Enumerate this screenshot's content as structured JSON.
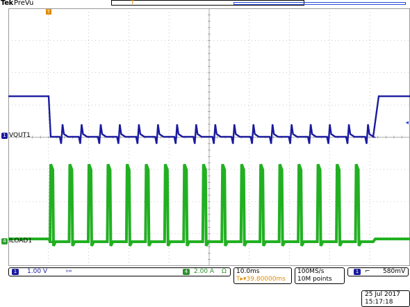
{
  "header": {
    "brand": "Tek",
    "mode": "PreVu",
    "record_trigger_glyph": "T"
  },
  "markers": {
    "ch1_number": "1",
    "ch1_label": "VOUT1",
    "ch4_number": "4",
    "ch4_label": "ILOAD1",
    "trigger_glyph": "T",
    "trigger_level_glyph": "◂"
  },
  "channel_settings": {
    "ch1_number": "1",
    "ch1_scale": "1.00 V",
    "ch1_bw_symbol": "ᵇᵂ",
    "ch4_number": "4",
    "ch4_scale": "2.00 A",
    "ch4_unit_symbol": "Ω"
  },
  "timebase": {
    "scale": "10.0ms",
    "position": "T▸▾39.80000ms"
  },
  "acquisition": {
    "sample_rate": "100MS/s",
    "record_length": "10M points"
  },
  "trigger": {
    "source": "1",
    "slope": "⌐",
    "level": "580mV"
  },
  "datetime": {
    "date": "25 Jul  2017",
    "time": "15:17:18"
  },
  "colors": {
    "ch1": "#1a1a9e",
    "ch4": "#22b022",
    "trigger": "#e08a00",
    "graticule": "#999999"
  },
  "waveform": {
    "ch1": {
      "high_level_div": 2.1,
      "low_level_div": 0,
      "pulse_count": 17,
      "pulse_period_ms": 5.0,
      "load_start_ms": -40.0,
      "load_end_ms": 55.0
    },
    "ch4": {
      "base_level_div": 0,
      "spike_height_div": 3.7,
      "pulse_count": 17
    }
  }
}
